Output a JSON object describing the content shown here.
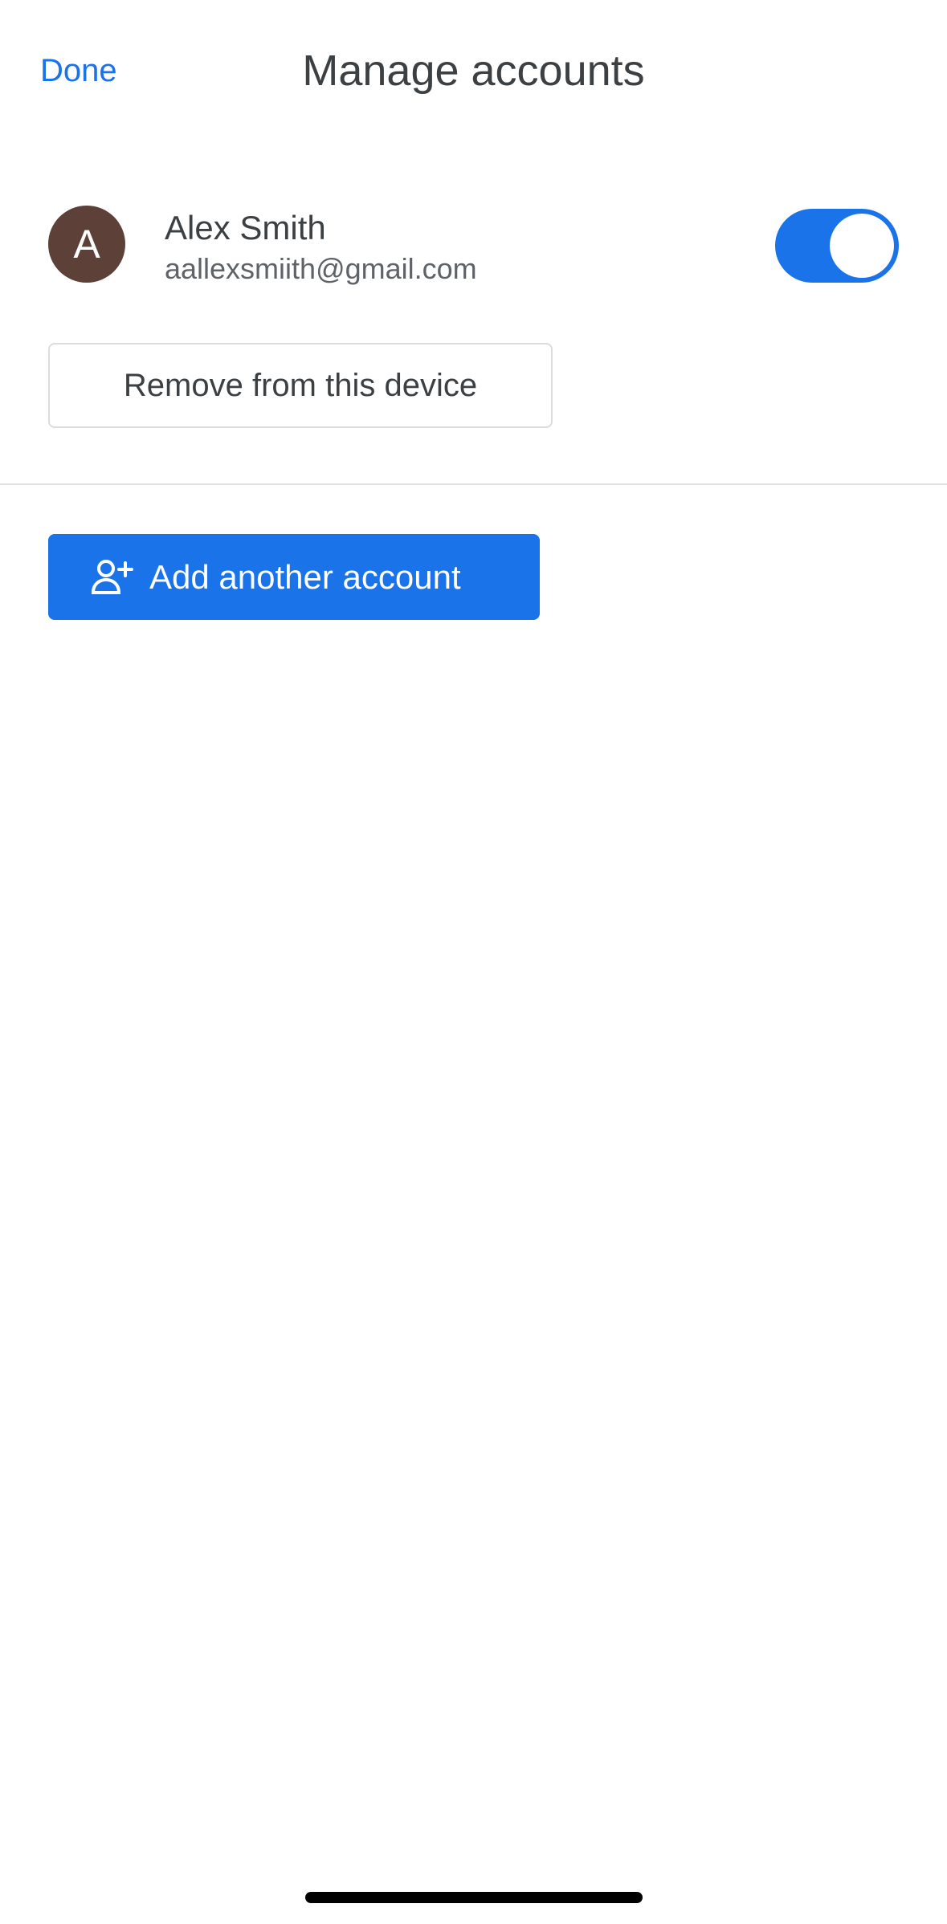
{
  "header": {
    "done_label": "Done",
    "title": "Manage accounts"
  },
  "account": {
    "avatar_initial": "A",
    "name": "Alex Smith",
    "email": "aallexsmiith@gmail.com",
    "enabled": true
  },
  "actions": {
    "remove_label": "Remove from this device",
    "add_label": "Add another account",
    "add_icon": "person-add-icon"
  },
  "colors": {
    "accent": "#1a73e8",
    "avatar_bg": "#5d4037",
    "text": "#3c4043",
    "secondary_text": "#5f6368"
  }
}
